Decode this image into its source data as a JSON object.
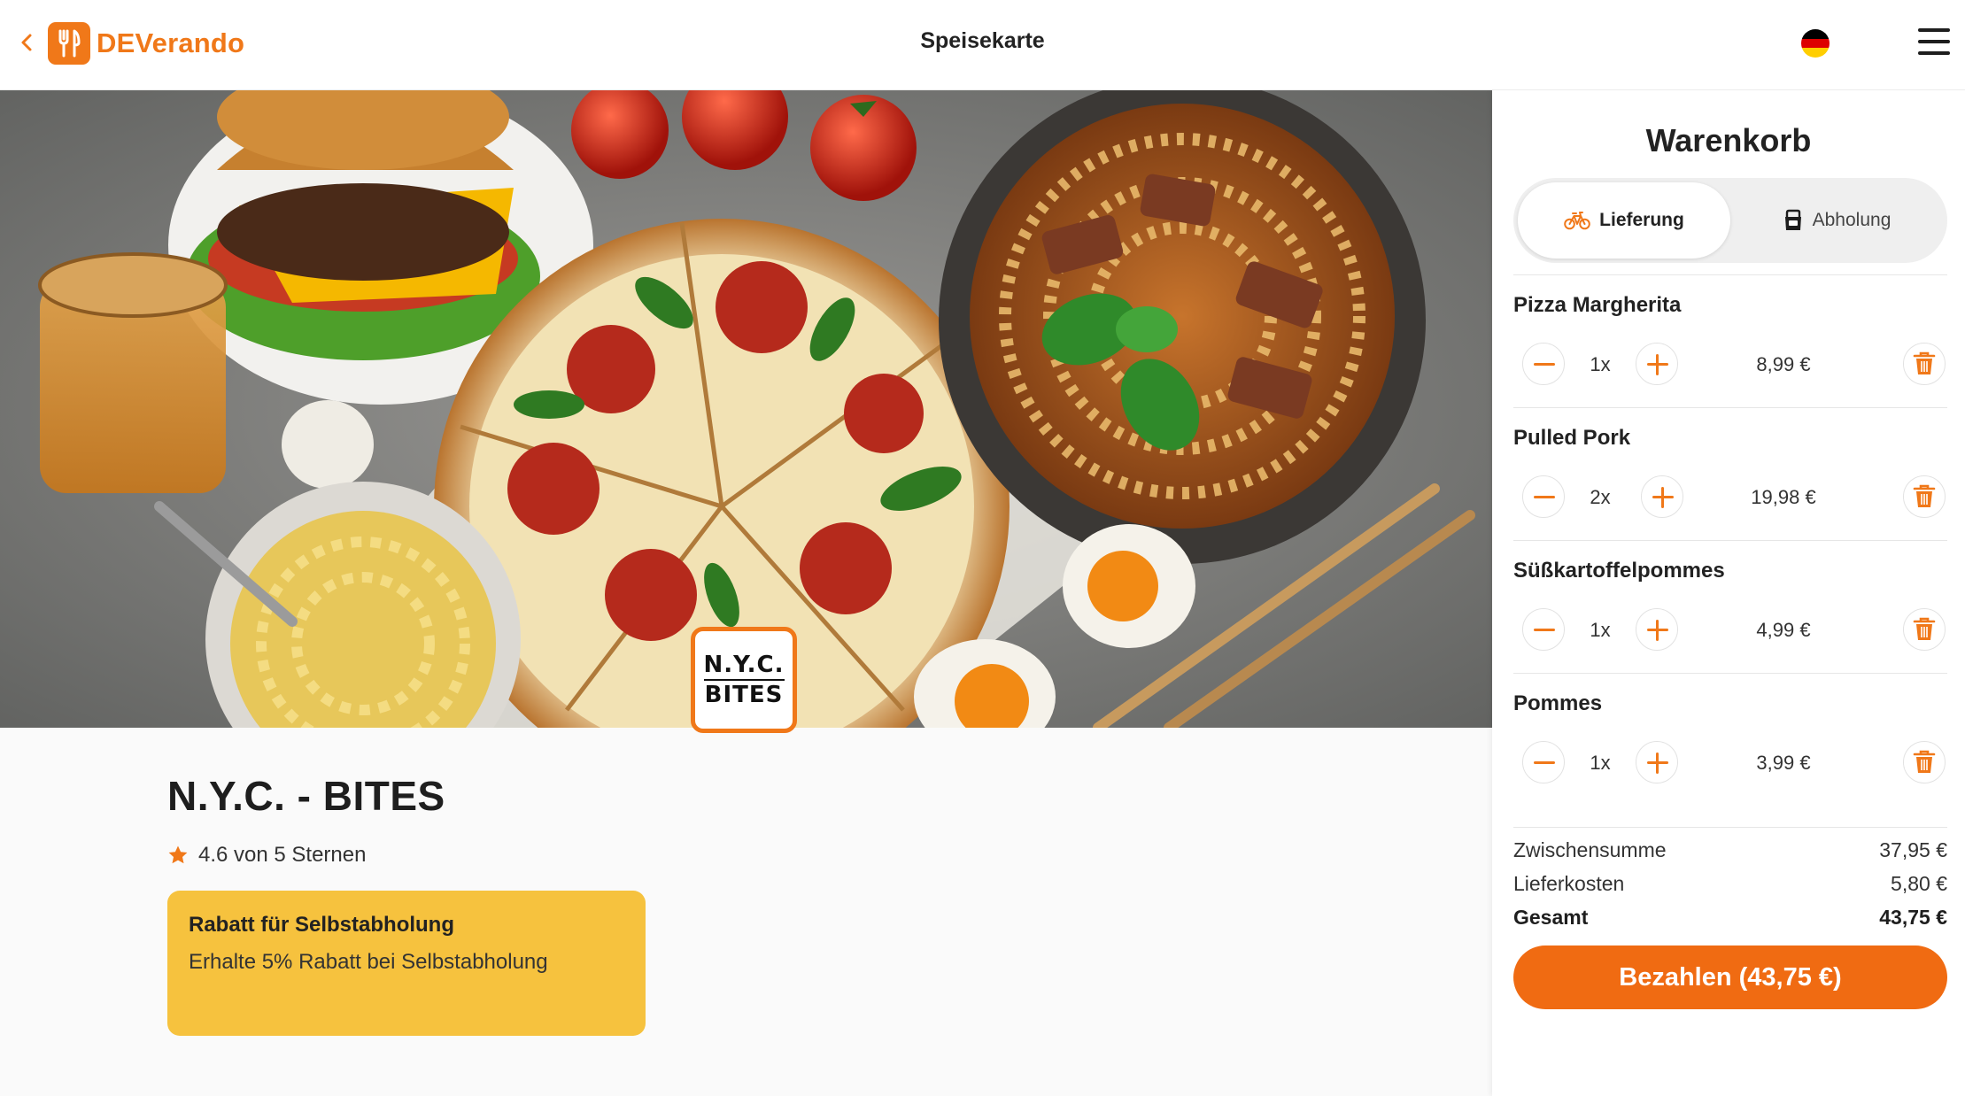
{
  "header": {
    "brand": "DEVerando",
    "title": "Speisekarte",
    "language": "de"
  },
  "restaurant": {
    "logo_line1": "N.Y.C.",
    "logo_line2": "BITES",
    "name": "N.Y.C. - BITES",
    "rating_text": "4.6 von 5 Sternen",
    "promo": {
      "title": "Rabatt für Selbstabholung",
      "text": "Erhalte 5% Rabatt bei Selbstabholung"
    }
  },
  "cart": {
    "title": "Warenkorb",
    "modes": {
      "delivery": "Lieferung",
      "pickup": "Abholung",
      "selected": "delivery"
    },
    "items": [
      {
        "name": "Pizza Margherita",
        "qty": "1x",
        "price": "8,99 €"
      },
      {
        "name": "Pulled Pork",
        "qty": "2x",
        "price": "19,98 €"
      },
      {
        "name": "Süßkartoffelpommes",
        "qty": "1x",
        "price": "4,99 €"
      },
      {
        "name": "Pommes",
        "qty": "1x",
        "price": "3,99 €"
      }
    ],
    "summary": {
      "subtotal_label": "Zwischensumme",
      "subtotal": "37,95 €",
      "delivery_label": "Lieferkosten",
      "delivery": "5,80 €",
      "total_label": "Gesamt",
      "total": "43,75 €"
    },
    "pay_label": "Bezahlen (43,75 €)"
  },
  "colors": {
    "accent": "#f07819",
    "promo": "#f6c23e",
    "pay": "#f06b12"
  }
}
